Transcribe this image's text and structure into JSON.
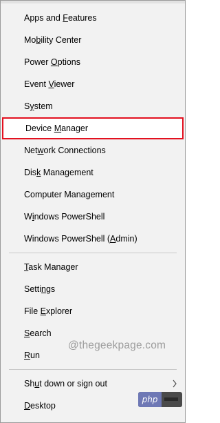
{
  "menu": {
    "groups": [
      [
        {
          "label": "Apps and Features",
          "key": "F"
        },
        {
          "label": "Mobility Center",
          "key": "b"
        },
        {
          "label": "Power Options",
          "key": "O"
        },
        {
          "label": "Event Viewer",
          "key": "V"
        },
        {
          "label": "System",
          "key": "y"
        },
        {
          "label": "Device Manager",
          "key": "M",
          "highlighted": true
        },
        {
          "label": "Network Connections",
          "key": "w"
        },
        {
          "label": "Disk Management",
          "key": "k"
        },
        {
          "label": "Computer Management",
          "key": "g"
        },
        {
          "label": "Windows PowerShell",
          "key": "i"
        },
        {
          "label": "Windows PowerShell (Admin)",
          "key": "A"
        }
      ],
      [
        {
          "label": "Task Manager",
          "key": "T"
        },
        {
          "label": "Settings",
          "key": "n"
        },
        {
          "label": "File Explorer",
          "key": "E"
        },
        {
          "label": "Search",
          "key": "S"
        },
        {
          "label": "Run",
          "key": "R"
        }
      ],
      [
        {
          "label": "Shut down or sign out",
          "key": "u",
          "submenu": true
        },
        {
          "label": "Desktop",
          "key": "D"
        }
      ]
    ]
  },
  "watermark": "@thegeekpage.com",
  "badge": {
    "text": "php"
  },
  "colors": {
    "menu_bg": "#f2f2f2",
    "highlight_border": "#e3101f",
    "separator": "#c8c8c8"
  }
}
